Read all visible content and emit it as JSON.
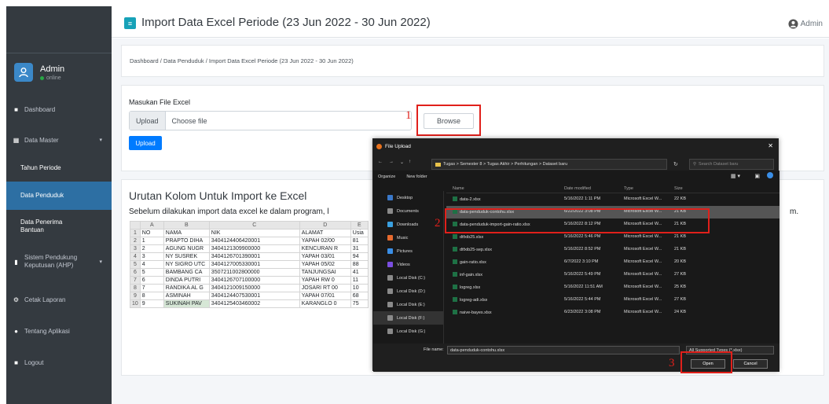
{
  "topbar": {
    "title": "Import Data Excel Periode (23 Jun 2022 - 30 Jun 2022)",
    "user_label": "Admin"
  },
  "sidebar": {
    "user": {
      "name": "Admin",
      "status": "online"
    },
    "items": [
      {
        "label": "Dashboard",
        "icon": "dashboard-icon"
      },
      {
        "label": "Data Master",
        "icon": "database-icon"
      },
      {
        "label": "Tahun Periode"
      },
      {
        "label": "Data Penduduk",
        "active": true
      },
      {
        "label": "Data Penerima Bantuan"
      },
      {
        "label": "Sistem Pendukung Keputusan (AHP)",
        "icon": "book-icon"
      },
      {
        "label": "Cetak Laporan",
        "icon": "gear-icon"
      },
      {
        "label": "Tentang Aplikasi",
        "icon": "info-icon"
      },
      {
        "label": "Logout",
        "icon": "logout-icon"
      }
    ]
  },
  "breadcrumb": "Dashboard / Data Penduduk / Import Data Excel Periode (23 Jun 2022 - 30 Jun 2022)",
  "upload_form": {
    "label": "Masukan File Excel",
    "upload_btn": "Upload",
    "placeholder": "Choose file",
    "browse_btn": "Browse",
    "upload_submit": "Upload"
  },
  "instructions": {
    "heading": "Urutan Kolom Untuk Import ke Excel",
    "text": "Sebelum dilakukan import data excel ke dalam program, l",
    "text_tail": "m."
  },
  "spreadsheet": {
    "col_letters": [
      "",
      "A",
      "B",
      "C",
      "D",
      "E"
    ],
    "rows": [
      [
        "1",
        "NO",
        "NAMA",
        "NIK",
        "ALAMAT",
        "Usia"
      ],
      [
        "2",
        "1",
        "PRAPTO DIHA",
        "3404124406420001",
        "YAPAH 02/00",
        "81"
      ],
      [
        "3",
        "2",
        "AGUNG NUGR",
        "3404121309900000",
        "KENCURAN R",
        "31"
      ],
      [
        "4",
        "3",
        "NY SUSREK",
        "3404126701390001",
        "YAPAH 03/01",
        "94"
      ],
      [
        "5",
        "4",
        "NY SIGRO UTC",
        "3404127005330001",
        "YAPAH 05/02",
        "88"
      ],
      [
        "6",
        "5",
        "BAMBANG CA",
        "3507211002800000",
        "TANJUNGSAI",
        "41"
      ],
      [
        "7",
        "6",
        "DINDA PUTRI",
        "3404126707100000",
        "YAPAH RW 0",
        "11"
      ],
      [
        "8",
        "7",
        "RANDIKA AL G",
        "3404121009150000",
        "JOSARI RT 00",
        "10"
      ],
      [
        "9",
        "8",
        "ASMINAH",
        "3404124407530001",
        "YAPAH 07/01",
        "68"
      ],
      [
        "10",
        "9",
        "SUKINAH PAV",
        "3404125403460002",
        "KARANGLO 0",
        "75"
      ]
    ]
  },
  "annotations": {
    "step1": "1",
    "step2": "2",
    "step3": "3"
  },
  "file_dialog": {
    "title": "File Upload",
    "address": "Tugas  >  Semester 8  >  Tugas Akhir  >  Perhitungan  >  Dataset baru",
    "search_placeholder": "Search Dataset baru",
    "organize": "Organize",
    "new_folder": "New folder",
    "nav_items": [
      "Desktop",
      "Documents",
      "Downloads",
      "Music",
      "Pictures",
      "Videos",
      "Local Disk (C:)",
      "Local Disk (D:)",
      "Local Disk (E:)",
      "Local Disk (F:)",
      "Local Disk (G:)"
    ],
    "columns": [
      "Name",
      "Date modified",
      "Type",
      "Size"
    ],
    "files": [
      {
        "name": "data-2.xlsx",
        "date": "5/16/2022 1:11 PM",
        "type": "Microsoft Excel W...",
        "size": "22 KB"
      },
      {
        "name": "data-penduduk-contohu.xlsx",
        "date": "6/22/2022 3:08 PM",
        "type": "Microsoft Excel W...",
        "size": "21 KB",
        "selected": true
      },
      {
        "name": "data-penduduk-import-gain-ratio.xlsx",
        "date": "5/16/2022 8:12 PM",
        "type": "Microsoft Excel W...",
        "size": "21 KB"
      },
      {
        "name": "dtfxib25.xlsx",
        "date": "5/16/2022 5:46 PM",
        "type": "Microsoft Excel W...",
        "size": "21 KB"
      },
      {
        "name": "dtfxib25-sep.xlsx",
        "date": "5/16/2022 8:52 PM",
        "type": "Microsoft Excel W...",
        "size": "21 KB"
      },
      {
        "name": "gain-ratio.xlsx",
        "date": "6/7/2022 3:10 PM",
        "type": "Microsoft Excel W...",
        "size": "20 KB"
      },
      {
        "name": "inf-gain.xlsx",
        "date": "5/16/2022 5:49 PM",
        "type": "Microsoft Excel W...",
        "size": "27 KB"
      },
      {
        "name": "logreg.xlsx",
        "date": "5/16/2022 11:51 AM",
        "type": "Microsoft Excel W...",
        "size": "25 KB"
      },
      {
        "name": "logreg-adi.xlsx",
        "date": "5/16/2022 5:44 PM",
        "type": "Microsoft Excel W...",
        "size": "27 KB"
      },
      {
        "name": "naive-bayes.xlsx",
        "date": "6/23/2022 3:08 PM",
        "type": "Microsoft Excel W...",
        "size": "24 KB"
      }
    ],
    "filename_label": "File name:",
    "filename_value": "data-penduduk-contohu.xlsx",
    "filetype": "All Supported Types (*.xlsx)",
    "open_btn": "Open",
    "cancel_btn": "Cancel"
  },
  "colors": {
    "sidebar_bg": "#343a40",
    "active": "#2d6fa3",
    "accent": "#17a2b8",
    "primary": "#007bff",
    "annotation": "#e0201b"
  }
}
